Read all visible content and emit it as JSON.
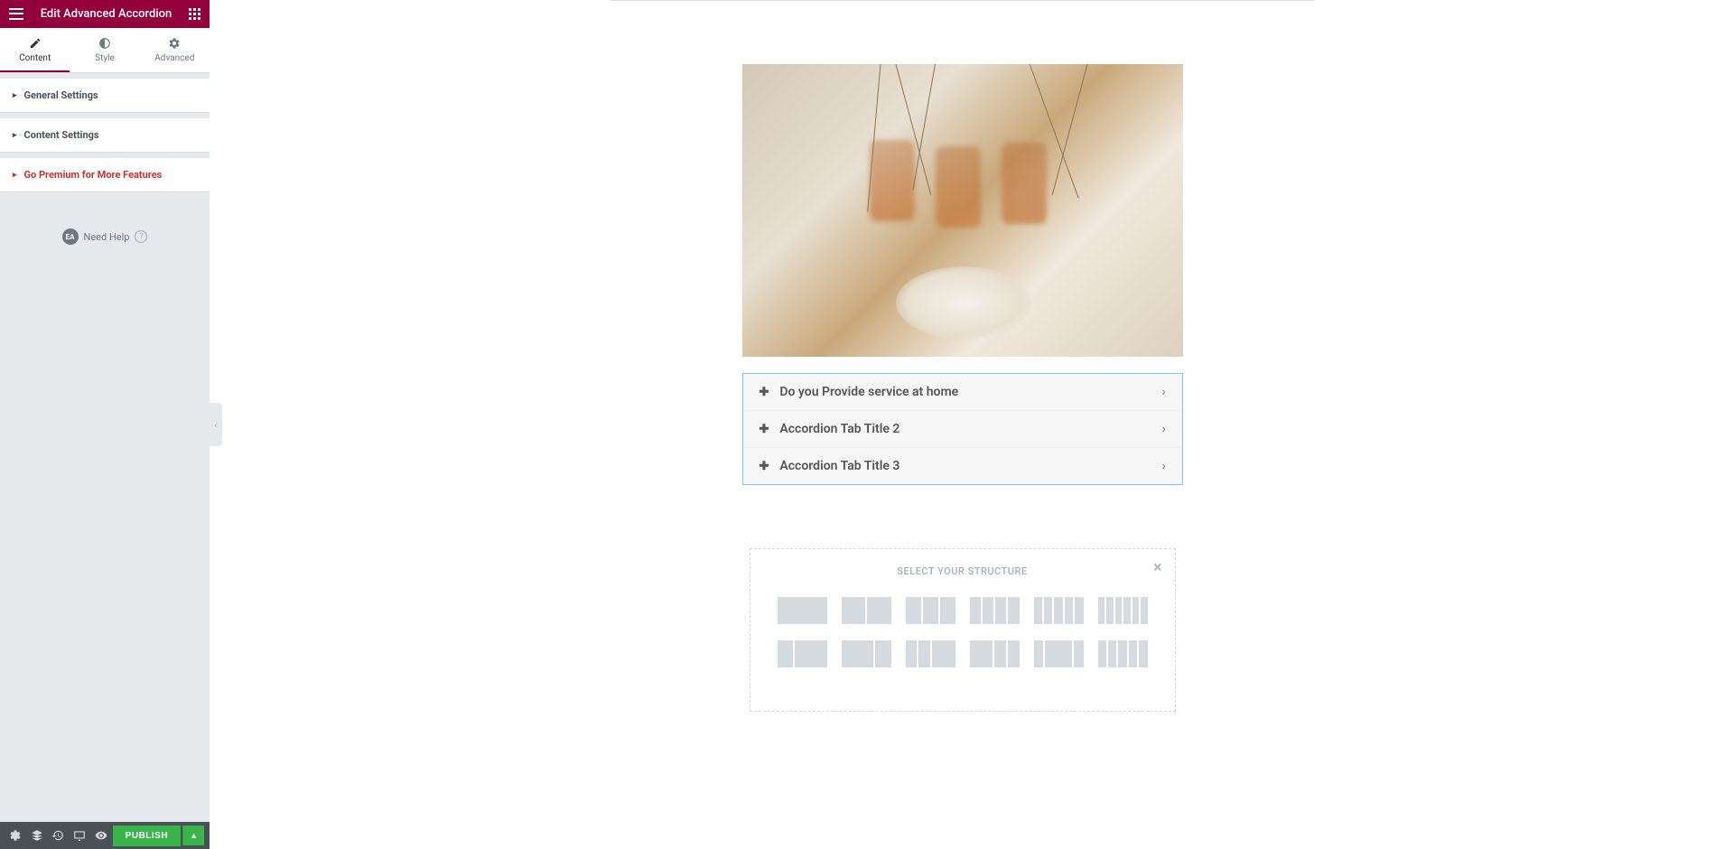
{
  "header": {
    "title": "Edit Advanced Accordion"
  },
  "tabs": {
    "content": "Content",
    "style": "Style",
    "advanced": "Advanced"
  },
  "sections": {
    "general": "General Settings",
    "content": "Content Settings",
    "premium": "Go Premium for More Features"
  },
  "help": {
    "badge": "EA",
    "label": "Need Help",
    "icon": "?"
  },
  "footer": {
    "publish": "PUBLISH"
  },
  "accordion": {
    "items": [
      {
        "title": "Do you Provide service at home"
      },
      {
        "title": "Accordion Tab Title 2"
      },
      {
        "title": "Accordion Tab Title 3"
      }
    ]
  },
  "structure": {
    "title": "SELECT YOUR STRUCTURE",
    "close": "×"
  }
}
